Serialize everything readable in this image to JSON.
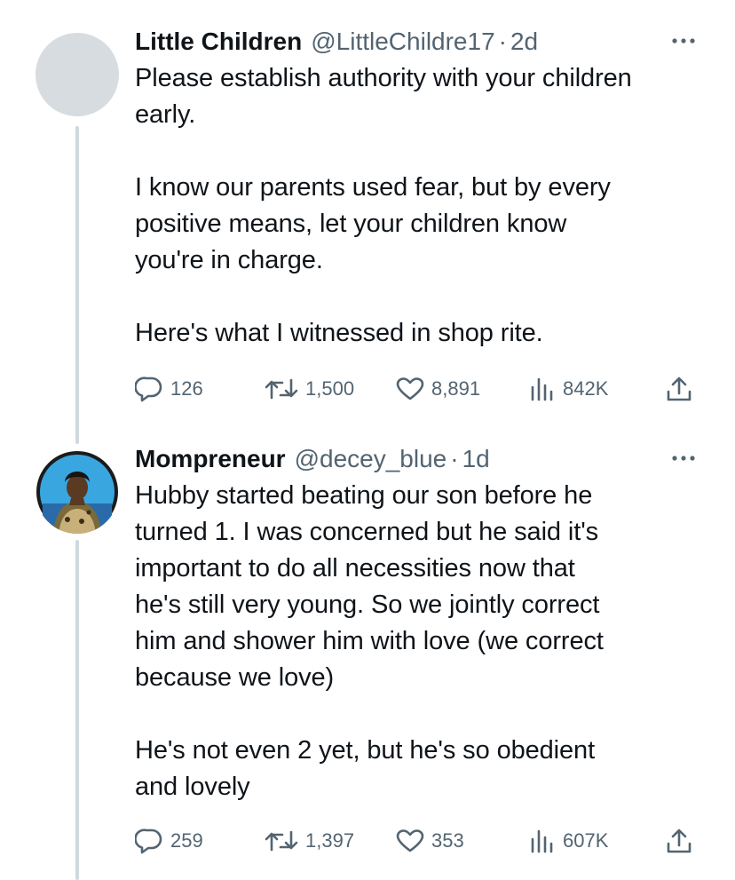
{
  "tweets": [
    {
      "author_name": "Little Children",
      "handle": "@LittleChildre17",
      "separator": "·",
      "age": "2d",
      "text": "Please establish authority with your children\nearly.\n\nI know our parents used fear, but by every\npositive means, let your children know\nyou're in charge.\n\nHere's what I witnessed in shop rite.",
      "replies": "126",
      "reposts": "1,500",
      "likes": "8,891",
      "views": "842K"
    },
    {
      "author_name": "Mompreneur",
      "handle": "@decey_blue",
      "separator": "·",
      "age": "1d",
      "text": "Hubby started beating our son before he\nturned 1. I was concerned but he said it's\nimportant to do all necessities now that\nhe's still very young. So we jointly correct\nhim and shower him with love (we correct\nbecause we love)\n\nHe's not even 2 yet, but he's so obedient\nand lovely",
      "replies": "259",
      "reposts": "1,397",
      "likes": "353",
      "views": "607K"
    }
  ],
  "colors": {
    "text": "#0f1419",
    "secondary": "#536471",
    "thread_line": "#cfd9de",
    "avatar_ring": "#1d9bf0"
  },
  "icons": {
    "reply": "reply-icon",
    "repost": "repost-icon",
    "like": "like-icon",
    "views": "views-icon",
    "share": "share-icon",
    "more": "more-icon"
  }
}
